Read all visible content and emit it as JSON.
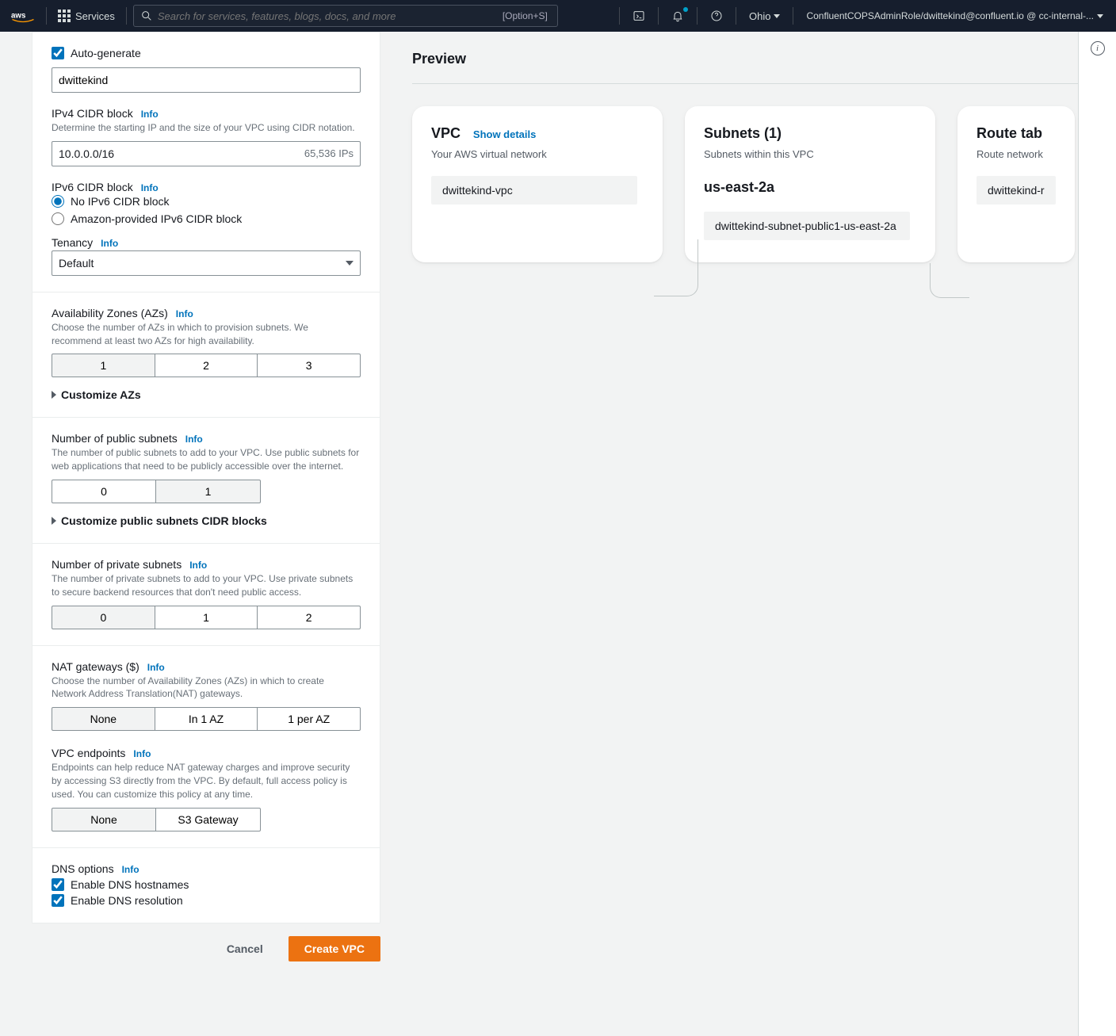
{
  "nav": {
    "services": "Services",
    "search_placeholder": "Search for services, features, blogs, docs, and more",
    "search_kbd": "[Option+S]",
    "region": "Ohio",
    "account": "ConfluentCOPSAdminRole/dwittekind@confluent.io @ cc-internal-..."
  },
  "form": {
    "autogen_label": "Auto-generate",
    "name_value": "dwittekind",
    "ipv4_label": "IPv4 CIDR block",
    "ipv4_help": "Determine the starting IP and the size of your VPC using CIDR notation.",
    "ipv4_value": "10.0.0.0/16",
    "ipv4_count": "65,536 IPs",
    "ipv6_label": "IPv6 CIDR block",
    "ipv6_opt1": "No IPv6 CIDR block",
    "ipv6_opt2": "Amazon-provided IPv6 CIDR block",
    "tenancy_label": "Tenancy",
    "tenancy_value": "Default",
    "az_label": "Availability Zones (AZs)",
    "az_help": "Choose the number of AZs in which to provision subnets. We recommend at least two AZs for high availability.",
    "az_opts": [
      "1",
      "2",
      "3"
    ],
    "az_customize": "Customize AZs",
    "pub_label": "Number of public subnets",
    "pub_help": "The number of public subnets to add to your VPC. Use public subnets for web applications that need to be publicly accessible over the internet.",
    "pub_opts": [
      "0",
      "1"
    ],
    "pub_customize": "Customize public subnets CIDR blocks",
    "priv_label": "Number of private subnets",
    "priv_help": "The number of private subnets to add to your VPC. Use private subnets to secure backend resources that don't need public access.",
    "priv_opts": [
      "0",
      "1",
      "2"
    ],
    "nat_label": "NAT gateways ($)",
    "nat_help": "Choose the number of Availability Zones (AZs) in which to create Network Address Translation(NAT) gateways.",
    "nat_opts": [
      "None",
      "In 1 AZ",
      "1 per AZ"
    ],
    "vpce_label": "VPC endpoints",
    "vpce_help": "Endpoints can help reduce NAT gateway charges and improve security by accessing S3 directly from the VPC. By default, full access policy is used. You can customize this policy at any time.",
    "vpce_opts": [
      "None",
      "S3 Gateway"
    ],
    "dns_label": "DNS options",
    "dns_hostnames": "Enable DNS hostnames",
    "dns_resolution": "Enable DNS resolution",
    "info": "Info",
    "cancel": "Cancel",
    "create": "Create VPC"
  },
  "preview": {
    "title": "Preview",
    "vpc_title": "VPC",
    "show_details": "Show details",
    "vpc_sub": "Your AWS virtual network",
    "vpc_pill": "dwittekind-vpc",
    "subnets_title": "Subnets (1)",
    "subnets_sub": "Subnets within this VPC",
    "subnets_az": "us-east-2a",
    "subnets_pill": "dwittekind-subnet-public1-us-east-2a",
    "rt_title": "Route tab",
    "rt_sub": "Route network",
    "rt_pill": "dwittekind-r"
  }
}
